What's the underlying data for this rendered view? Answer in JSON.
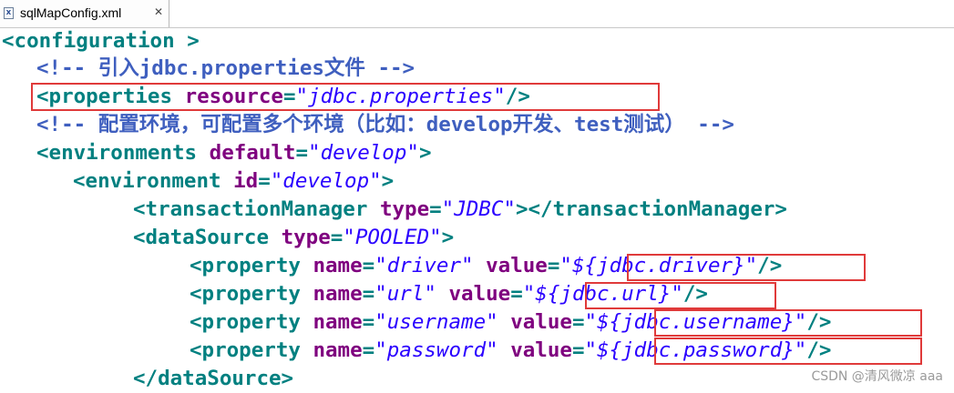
{
  "tab": {
    "icon": "xml-file-icon",
    "label": "sqlMapConfig.xml",
    "close": "✕"
  },
  "code": {
    "l1": {
      "tag": "<configuration >"
    },
    "l2": {
      "comment": "<!-- 引入jdbc.properties文件 -->"
    },
    "l3": {
      "open": "<properties ",
      "attr": "resource",
      "eq": "=",
      "value": "\"jdbc.properties\"",
      "close": "/>"
    },
    "l4": {
      "comment": "<!-- 配置环境，可配置多个环境（比如：develop开发、test测试） -->"
    },
    "l5": {
      "open": "<environments ",
      "attr": "default",
      "eq": "=",
      "value": "\"develop\"",
      "close": ">"
    },
    "l6": {
      "open": "<environment ",
      "attr": "id",
      "eq": "=",
      "value": "\"develop\"",
      "close": ">"
    },
    "l7": {
      "open": "<transactionManager ",
      "attr": "type",
      "eq": "=",
      "value": "\"JDBC\"",
      "close": "></transactionManager>"
    },
    "l8": {
      "open": "<dataSource ",
      "attr": "type",
      "eq": "=",
      "value": "\"POOLED\"",
      "close": ">"
    },
    "l9": {
      "open": "<property ",
      "a1": "name",
      "eq": "=",
      "v1": "\"driver\"",
      "a2": "value",
      "v2": "\"${jdbc.driver}\"",
      "close": "/>"
    },
    "l10": {
      "open": "<property ",
      "a1": "name",
      "eq": "=",
      "v1": "\"url\"",
      "a2": "value",
      "v2": "\"${jdbc.url}\"",
      "close": "/>"
    },
    "l11": {
      "open": "<property ",
      "a1": "name",
      "eq": "=",
      "v1": "\"username\"",
      "a2": "value",
      "v2": "\"${jdbc.username}\"",
      "close": "/>"
    },
    "l12": {
      "open": "<property ",
      "a1": "name",
      "eq": "=",
      "v1": "\"password\"",
      "a2": "value",
      "v2": "\"${jdbc.password}\"",
      "close": "/>"
    },
    "l13": {
      "tag": "</dataSource>"
    }
  },
  "watermark": "CSDN @清风微凉 aaa",
  "colors": {
    "tag": "#008080",
    "attribute": "#7f007f",
    "value": "#2a00ff",
    "comment": "#3f5fbf",
    "highlight": "#e03a3a"
  }
}
